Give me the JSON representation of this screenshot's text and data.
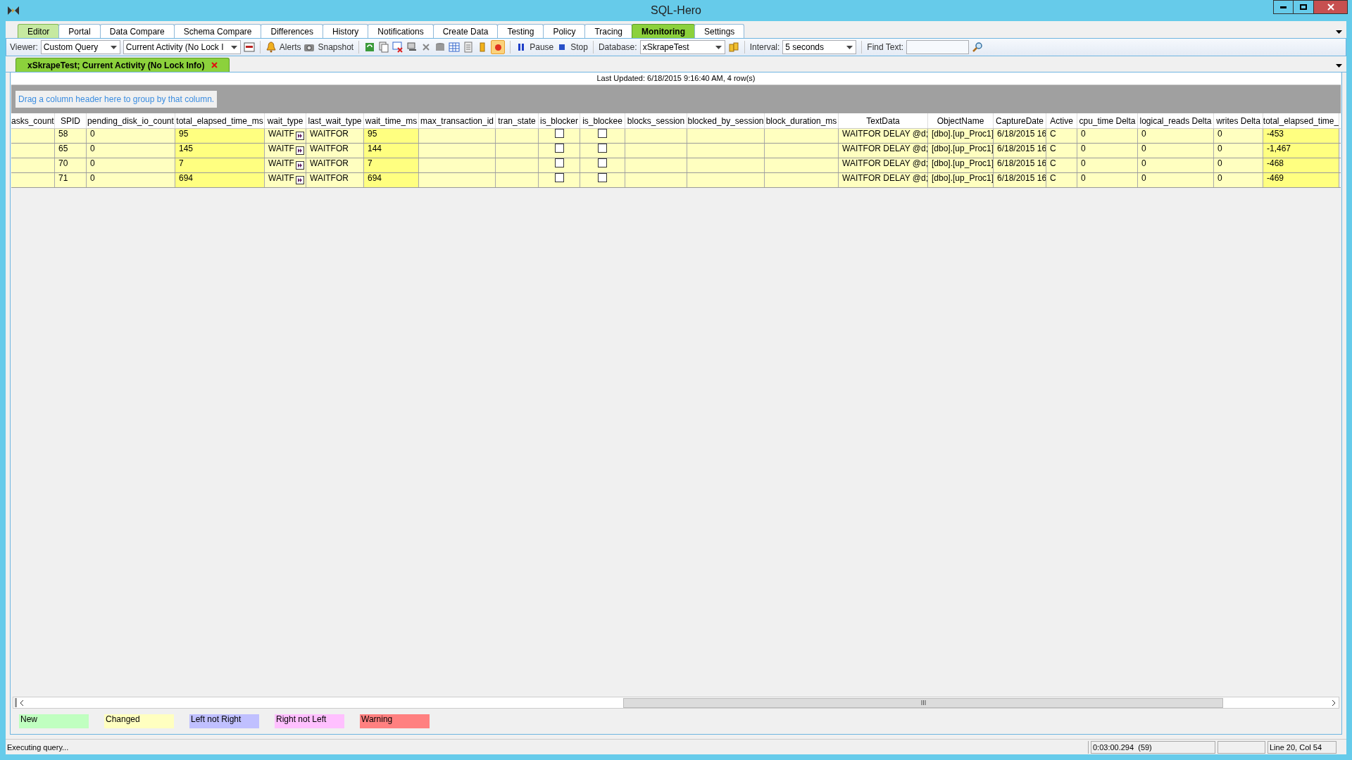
{
  "window": {
    "title": "SQL-Hero"
  },
  "tabs": [
    {
      "label": "Editor",
      "selected": false,
      "kind": "green"
    },
    {
      "label": "Portal",
      "selected": false,
      "kind": "plain"
    },
    {
      "label": "Data Compare",
      "selected": false,
      "kind": "plain"
    },
    {
      "label": "Schema Compare",
      "selected": false,
      "kind": "plain"
    },
    {
      "label": "Differences",
      "selected": false,
      "kind": "plain"
    },
    {
      "label": "History",
      "selected": false,
      "kind": "plain"
    },
    {
      "label": "Notifications",
      "selected": false,
      "kind": "plain"
    },
    {
      "label": "Create Data",
      "selected": false,
      "kind": "plain"
    },
    {
      "label": "Testing",
      "selected": false,
      "kind": "plain"
    },
    {
      "label": "Policy",
      "selected": false,
      "kind": "plain"
    },
    {
      "label": "Tracing",
      "selected": false,
      "kind": "plain"
    },
    {
      "label": "Monitoring",
      "selected": true,
      "kind": "green"
    },
    {
      "label": "Settings",
      "selected": false,
      "kind": "plain"
    }
  ],
  "toolbar": {
    "viewer_label": "Viewer:",
    "viewer": "Custom Query",
    "query": "Current Activity (No Lock I",
    "alerts": "Alerts",
    "snapshot": "Snapshot",
    "pause": "Pause",
    "stop": "Stop",
    "database_label": "Database:",
    "database": "xSkrapeTest",
    "interval_label": "Interval:",
    "interval": "5 seconds",
    "find_label": "Find Text:",
    "record_on": true
  },
  "document_tab": {
    "label": "xSkrapeTest; Current Activity (No Lock Info)"
  },
  "last_updated": "Last Updated: 6/18/2015 9:16:40 AM, 4 row(s)",
  "group_hint": "Drag a column header here to group by that column.",
  "table": {
    "columns": [
      {
        "label": "asks_count",
        "kind": "text",
        "highlighted": false
      },
      {
        "label": "SPID",
        "kind": "text",
        "highlighted": false
      },
      {
        "label": "pending_disk_io_count",
        "kind": "text",
        "highlighted": false
      },
      {
        "label": "total_elapsed_time_ms",
        "kind": "text",
        "highlighted": true
      },
      {
        "label": "wait_type",
        "kind": "expand",
        "highlighted": false
      },
      {
        "label": "last_wait_type",
        "kind": "text",
        "highlighted": false
      },
      {
        "label": "wait_time_ms",
        "kind": "text",
        "highlighted": true
      },
      {
        "label": "max_transaction_id",
        "kind": "text",
        "highlighted": false
      },
      {
        "label": "tran_state",
        "kind": "text",
        "highlighted": false
      },
      {
        "label": "is_blocker",
        "kind": "check",
        "highlighted": false
      },
      {
        "label": "is_blockee",
        "kind": "check",
        "highlighted": false
      },
      {
        "label": "blocks_session",
        "kind": "text",
        "highlighted": false
      },
      {
        "label": "blocked_by_session",
        "kind": "text",
        "highlighted": false
      },
      {
        "label": "block_duration_ms",
        "kind": "text",
        "highlighted": false
      },
      {
        "label": "TextData",
        "kind": "text",
        "highlighted": false
      },
      {
        "label": "ObjectName",
        "kind": "text",
        "highlighted": false
      },
      {
        "label": "CaptureDate",
        "kind": "text",
        "highlighted": false
      },
      {
        "label": "Active",
        "kind": "text",
        "highlighted": false
      },
      {
        "label": "cpu_time Delta",
        "kind": "text",
        "highlighted": false
      },
      {
        "label": "logical_reads Delta",
        "kind": "text",
        "highlighted": false
      },
      {
        "label": "writes Delta",
        "kind": "text",
        "highlighted": false
      },
      {
        "label": "total_elapsed_time_",
        "kind": "text",
        "highlighted": true
      }
    ],
    "rows": [
      {
        "cells": [
          null,
          "58",
          "0",
          "95",
          "WAITF",
          "WAITFOR",
          "95",
          null,
          null,
          {
            "checked": false
          },
          {
            "checked": false
          },
          null,
          null,
          null,
          "WAITFOR DELAY @d;",
          "[dbo].[up_Proc1]",
          "6/18/2015 16",
          "C",
          "0",
          "0",
          "0",
          "-453"
        ]
      },
      {
        "cells": [
          null,
          "65",
          "0",
          "145",
          "WAITF",
          "WAITFOR",
          "144",
          null,
          null,
          {
            "checked": false
          },
          {
            "checked": false
          },
          null,
          null,
          null,
          "WAITFOR DELAY @d;",
          "[dbo].[up_Proc1]",
          "6/18/2015 16",
          "C",
          "0",
          "0",
          "0",
          "-1,467"
        ]
      },
      {
        "cells": [
          null,
          "70",
          "0",
          "7",
          "WAITF",
          "WAITFOR",
          "7",
          null,
          null,
          {
            "checked": false
          },
          {
            "checked": false
          },
          null,
          null,
          null,
          "WAITFOR DELAY @d;",
          "[dbo].[up_Proc1]",
          "6/18/2015 16",
          "C",
          "0",
          "0",
          "0",
          "-468"
        ]
      },
      {
        "cells": [
          null,
          "71",
          "0",
          "694",
          "WAITF",
          "WAITFOR",
          "694",
          null,
          null,
          {
            "checked": false
          },
          {
            "checked": false
          },
          null,
          null,
          null,
          "WAITFOR DELAY @d;",
          "[dbo].[up_Proc1]",
          "6/18/2015 16",
          "C",
          "0",
          "0",
          "0",
          "-469"
        ]
      }
    ]
  },
  "legend": [
    {
      "label": "New",
      "color": "#c0ffc0"
    },
    {
      "label": "Changed",
      "color": "#ffffc0"
    },
    {
      "label": "Left not Right",
      "color": "#c0c0ff"
    },
    {
      "label": "Right not Left",
      "color": "#ffc0ff"
    },
    {
      "label": "Warning",
      "color": "#ff8080"
    }
  ],
  "status_bar": {
    "message": "Executing query...",
    "elapsed": "0:03:00.294  (59)",
    "position": "Line 20, Col 54"
  }
}
